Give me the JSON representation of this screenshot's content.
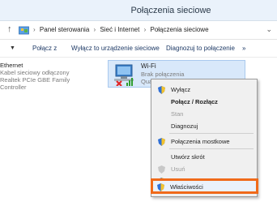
{
  "window": {
    "title": "Połączenia sieciowe"
  },
  "addressbar": {
    "up_glyph": "↑",
    "crumbs": [
      "Panel sterowania",
      "Sieć i Internet",
      "Połączenia sieciowe"
    ],
    "dropdown_glyph": "⌄"
  },
  "toolbar": {
    "caret": "▼",
    "connect": "Połącz z",
    "disable": "Wyłącz to urządzenie sieciowe",
    "diagnose": "Diagnozuj to połączenie",
    "more": "»"
  },
  "adapters": {
    "ethernet": {
      "name": "Ethernet",
      "status": "Kabel sieciowy odłączony",
      "device": "Realtek PCIe GBE Family Controller"
    },
    "wifi": {
      "name": "Wi-Fi",
      "status": "Brak połączenia",
      "device_partial": "Qual"
    }
  },
  "context_menu": {
    "items": [
      {
        "label": "Wyłącz",
        "icon": "shield-icon"
      },
      {
        "label": "Połącz / Rozłącz"
      },
      {
        "label": "Stan"
      },
      {
        "label": "Diagnozuj"
      },
      {
        "label": "Połączenia mostkowe",
        "icon": "shield-icon"
      },
      {
        "label": "Utwórz skrót"
      },
      {
        "label": "Usuń",
        "icon": "shield-icon"
      },
      {
        "label": "Zmień nazwę",
        "icon": "shield-icon"
      },
      {
        "label": "Właściwości",
        "icon": "shield-icon"
      }
    ]
  },
  "colors": {
    "highlight": "#f06a1a",
    "selection": "#d8e8fa"
  }
}
